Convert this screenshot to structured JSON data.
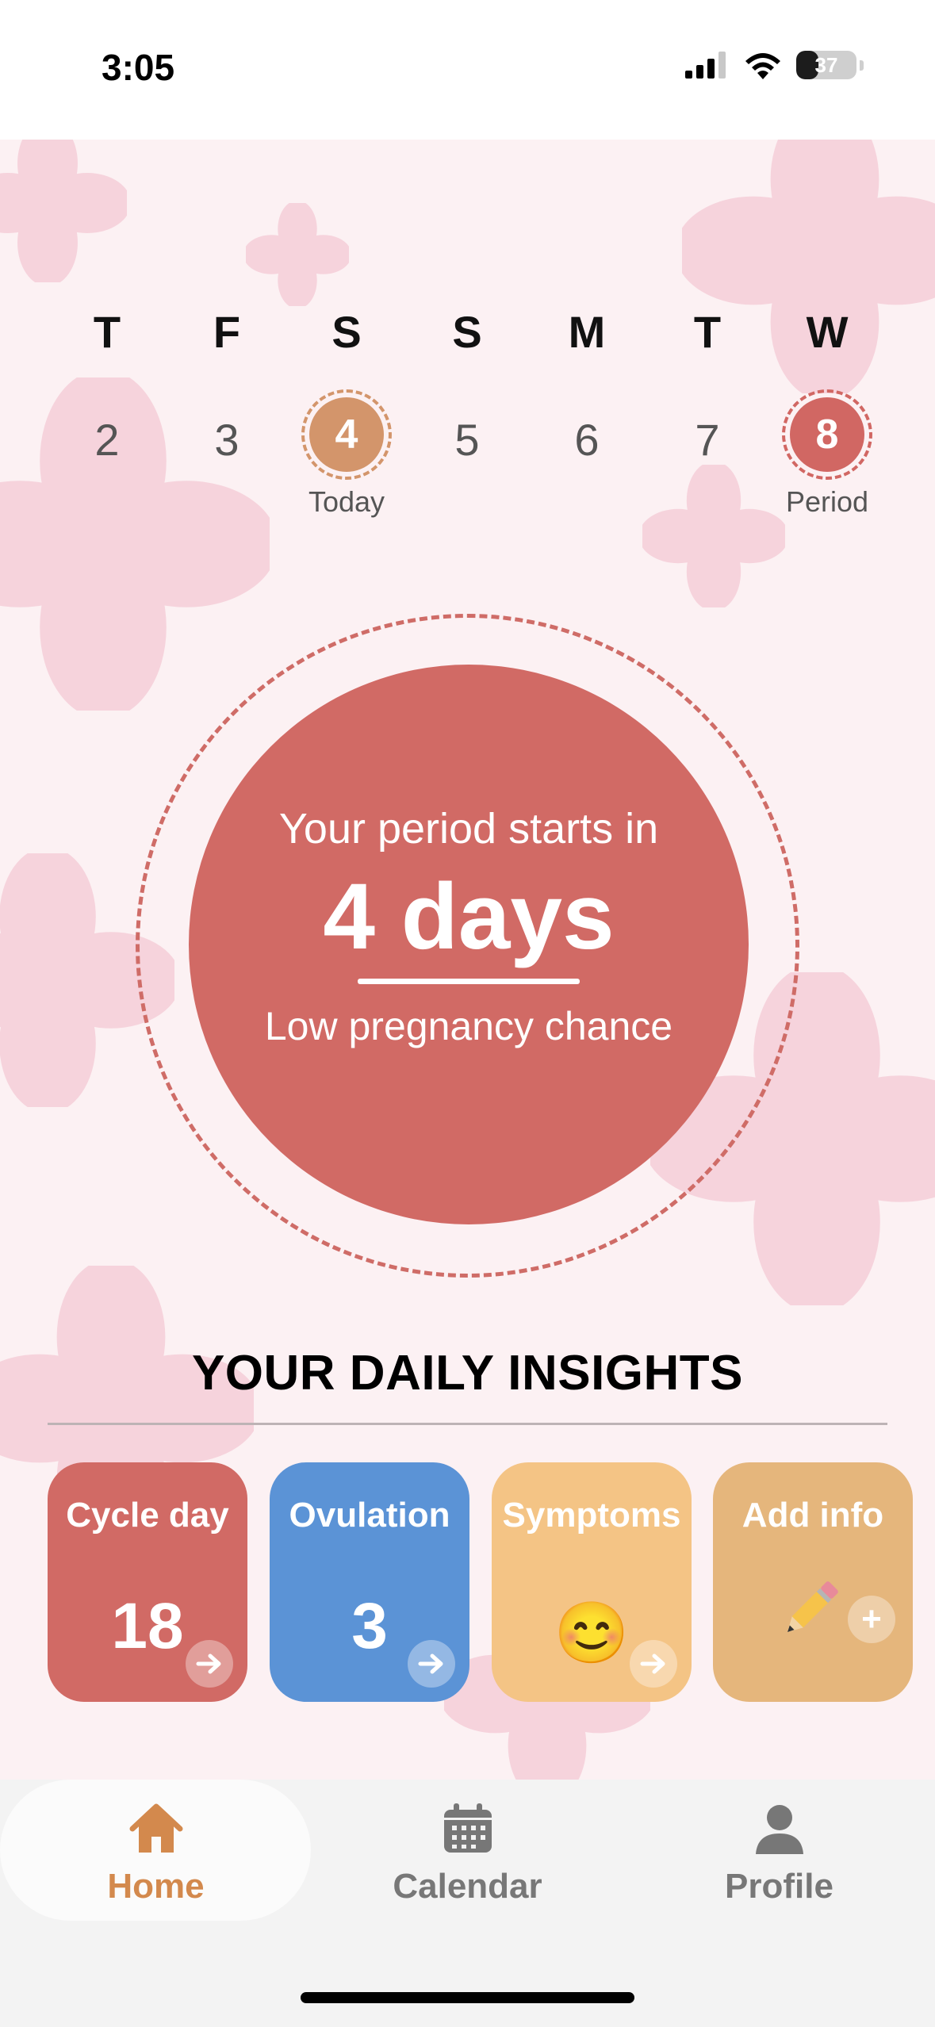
{
  "status_bar": {
    "time": "3:05",
    "battery_level": "37",
    "icons": [
      "signal-icon",
      "wifi-icon",
      "battery-icon"
    ]
  },
  "week": {
    "days": [
      {
        "letter": "T",
        "number": "2",
        "caption": ""
      },
      {
        "letter": "F",
        "number": "3",
        "caption": ""
      },
      {
        "letter": "S",
        "number": "4",
        "caption": "Today",
        "state": "today"
      },
      {
        "letter": "S",
        "number": "5",
        "caption": ""
      },
      {
        "letter": "M",
        "number": "6",
        "caption": ""
      },
      {
        "letter": "T",
        "number": "7",
        "caption": ""
      },
      {
        "letter": "W",
        "number": "8",
        "caption": "Period",
        "state": "period"
      }
    ]
  },
  "period": {
    "intro": "Your period starts in",
    "days": "4 days",
    "chance": "Low pregnancy chance"
  },
  "insights": {
    "title": "YOUR DAILY INSIGHTS",
    "cards": [
      {
        "label": "Cycle day",
        "value": "18",
        "color": "#d16a65",
        "icon": "arrow-right-icon"
      },
      {
        "label": "Ovulation",
        "value": "3",
        "color": "#5b93d6",
        "icon": "arrow-right-icon"
      },
      {
        "label": "Symptoms",
        "emoji": "😊",
        "color": "#f4c485",
        "icon": "arrow-right-icon"
      },
      {
        "label": "Add info",
        "emoji": "pencil-icon",
        "color": "#e5b67c",
        "icon": "plus-icon"
      }
    ]
  },
  "tabs": [
    {
      "label": "Home",
      "icon": "home-icon",
      "active": true,
      "color": "#d3894d"
    },
    {
      "label": "Calendar",
      "icon": "calendar-icon",
      "active": false,
      "color": "#777777"
    },
    {
      "label": "Profile",
      "icon": "profile-icon",
      "active": false,
      "color": "#777777"
    }
  ],
  "colors": {
    "accent": "#d16a65",
    "today": "#d3956b",
    "background": "#fcf1f3"
  }
}
